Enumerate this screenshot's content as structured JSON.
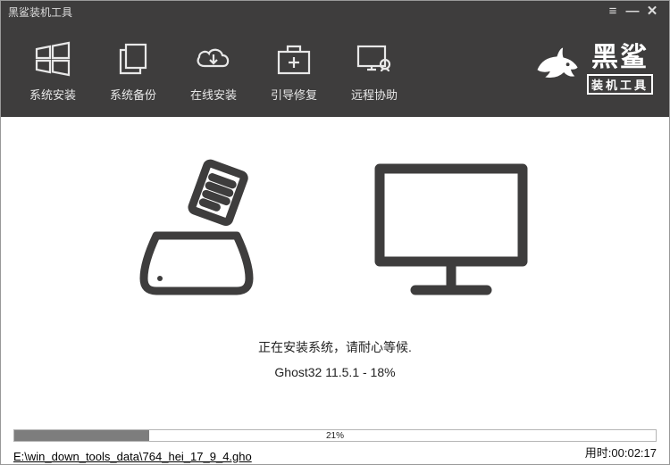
{
  "titlebar": {
    "title": "黑鲨装机工具"
  },
  "tabs": [
    {
      "label": "系统安装"
    },
    {
      "label": "系统备份"
    },
    {
      "label": "在线安装"
    },
    {
      "label": "引导修复"
    },
    {
      "label": "远程协助"
    }
  ],
  "logo": {
    "line1": "黑鲨",
    "line2": "装机工具"
  },
  "status": {
    "line1": "正在安装系统，请耐心等候.",
    "line2": "Ghost32 11.5.1 - 18%"
  },
  "progress": {
    "percent": 21,
    "label": "21%"
  },
  "time": {
    "label": "用时:",
    "value": "00:02:17"
  },
  "path": "E:\\win_down_tools_data\\764_hei_17_9_4.gho"
}
